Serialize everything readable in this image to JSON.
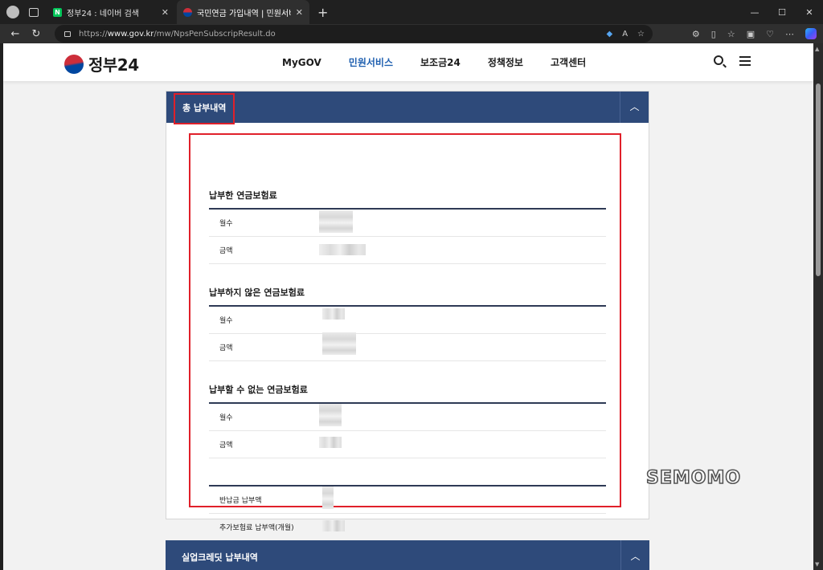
{
  "browser": {
    "tabs": [
      {
        "title": "정부24 : 네이버 검색",
        "favicon": "naver-n",
        "active": false
      },
      {
        "title": "국민연금 가입내역 | 민원서비스 |",
        "favicon": "gov-taegeuk",
        "active": true
      }
    ],
    "new_tab": "+",
    "url_prefix": "https://",
    "url_host": "www.gov.kr",
    "url_path": "/mw/NpsPenSubscripResult.do",
    "window_controls": [
      "—",
      "☐",
      "✕"
    ]
  },
  "site": {
    "logo_text": "정부24",
    "nav": [
      "MyGOV",
      "민원서비스",
      "보조금24",
      "정책정보",
      "고객센터"
    ],
    "active_nav": "민원서비스"
  },
  "card": {
    "title": "총 납부내역",
    "collapse_icon": "chevron-up-icon",
    "sections": [
      {
        "title": "납부한 연금보험료",
        "rows": [
          "월수",
          "금액"
        ]
      },
      {
        "title": "납부하지 않은 연금보험료",
        "rows": [
          "월수",
          "금액"
        ]
      },
      {
        "title": "납부할 수 없는 연금보험료",
        "rows": [
          "월수",
          "금액"
        ]
      },
      {
        "title": "",
        "rows": [
          "반납금 납부액",
          "추가보험료 납부액(개월)"
        ]
      }
    ]
  },
  "card2": {
    "title": "실업크레딧 납부내역"
  },
  "watermark": "SEMOMO",
  "colors": {
    "header_navy": "#2e4a7a",
    "highlight_red": "#e0202a",
    "active_nav_blue": "#2060b0"
  }
}
